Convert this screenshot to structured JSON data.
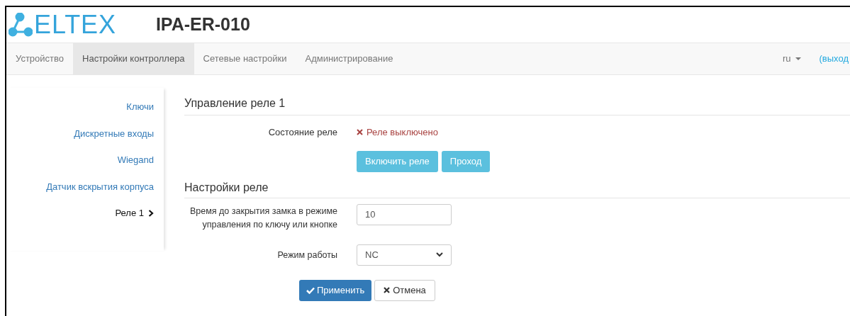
{
  "header": {
    "logo": "ELTEX",
    "title": "IPA-ER-010"
  },
  "nav": {
    "tabs": [
      {
        "label": "Устройство",
        "selected": false
      },
      {
        "label": "Настройки контроллера",
        "selected": true
      },
      {
        "label": "Сетевые настройки",
        "selected": false
      },
      {
        "label": "Администрирование",
        "selected": false
      }
    ],
    "language": "ru",
    "logout": "(выход"
  },
  "sidebar": {
    "items": [
      {
        "label": "Ключи",
        "selected": false
      },
      {
        "label": "Дискретные входы",
        "selected": false
      },
      {
        "label": "Wiegand",
        "selected": false
      },
      {
        "label": "Датчик вскрытия корпуса",
        "selected": false
      },
      {
        "label": "Реле 1",
        "selected": true
      }
    ]
  },
  "relay_control": {
    "heading": "Управление реле 1",
    "state_label": "Состояние реле",
    "state": {
      "text": "Реле выключено",
      "on": false
    },
    "buttons": [
      "Включить реле",
      "Проход"
    ]
  },
  "relay_settings": {
    "heading": "Настройки реле",
    "fields": [
      {
        "kind": "input",
        "label": "Время до закрытия замка в режиме управления по ключу или кнопке",
        "value": "10"
      },
      {
        "kind": "select",
        "label": "Режим работы",
        "value": "NC"
      }
    ]
  },
  "actions": {
    "apply": "Применить",
    "cancel": "Отмена"
  }
}
